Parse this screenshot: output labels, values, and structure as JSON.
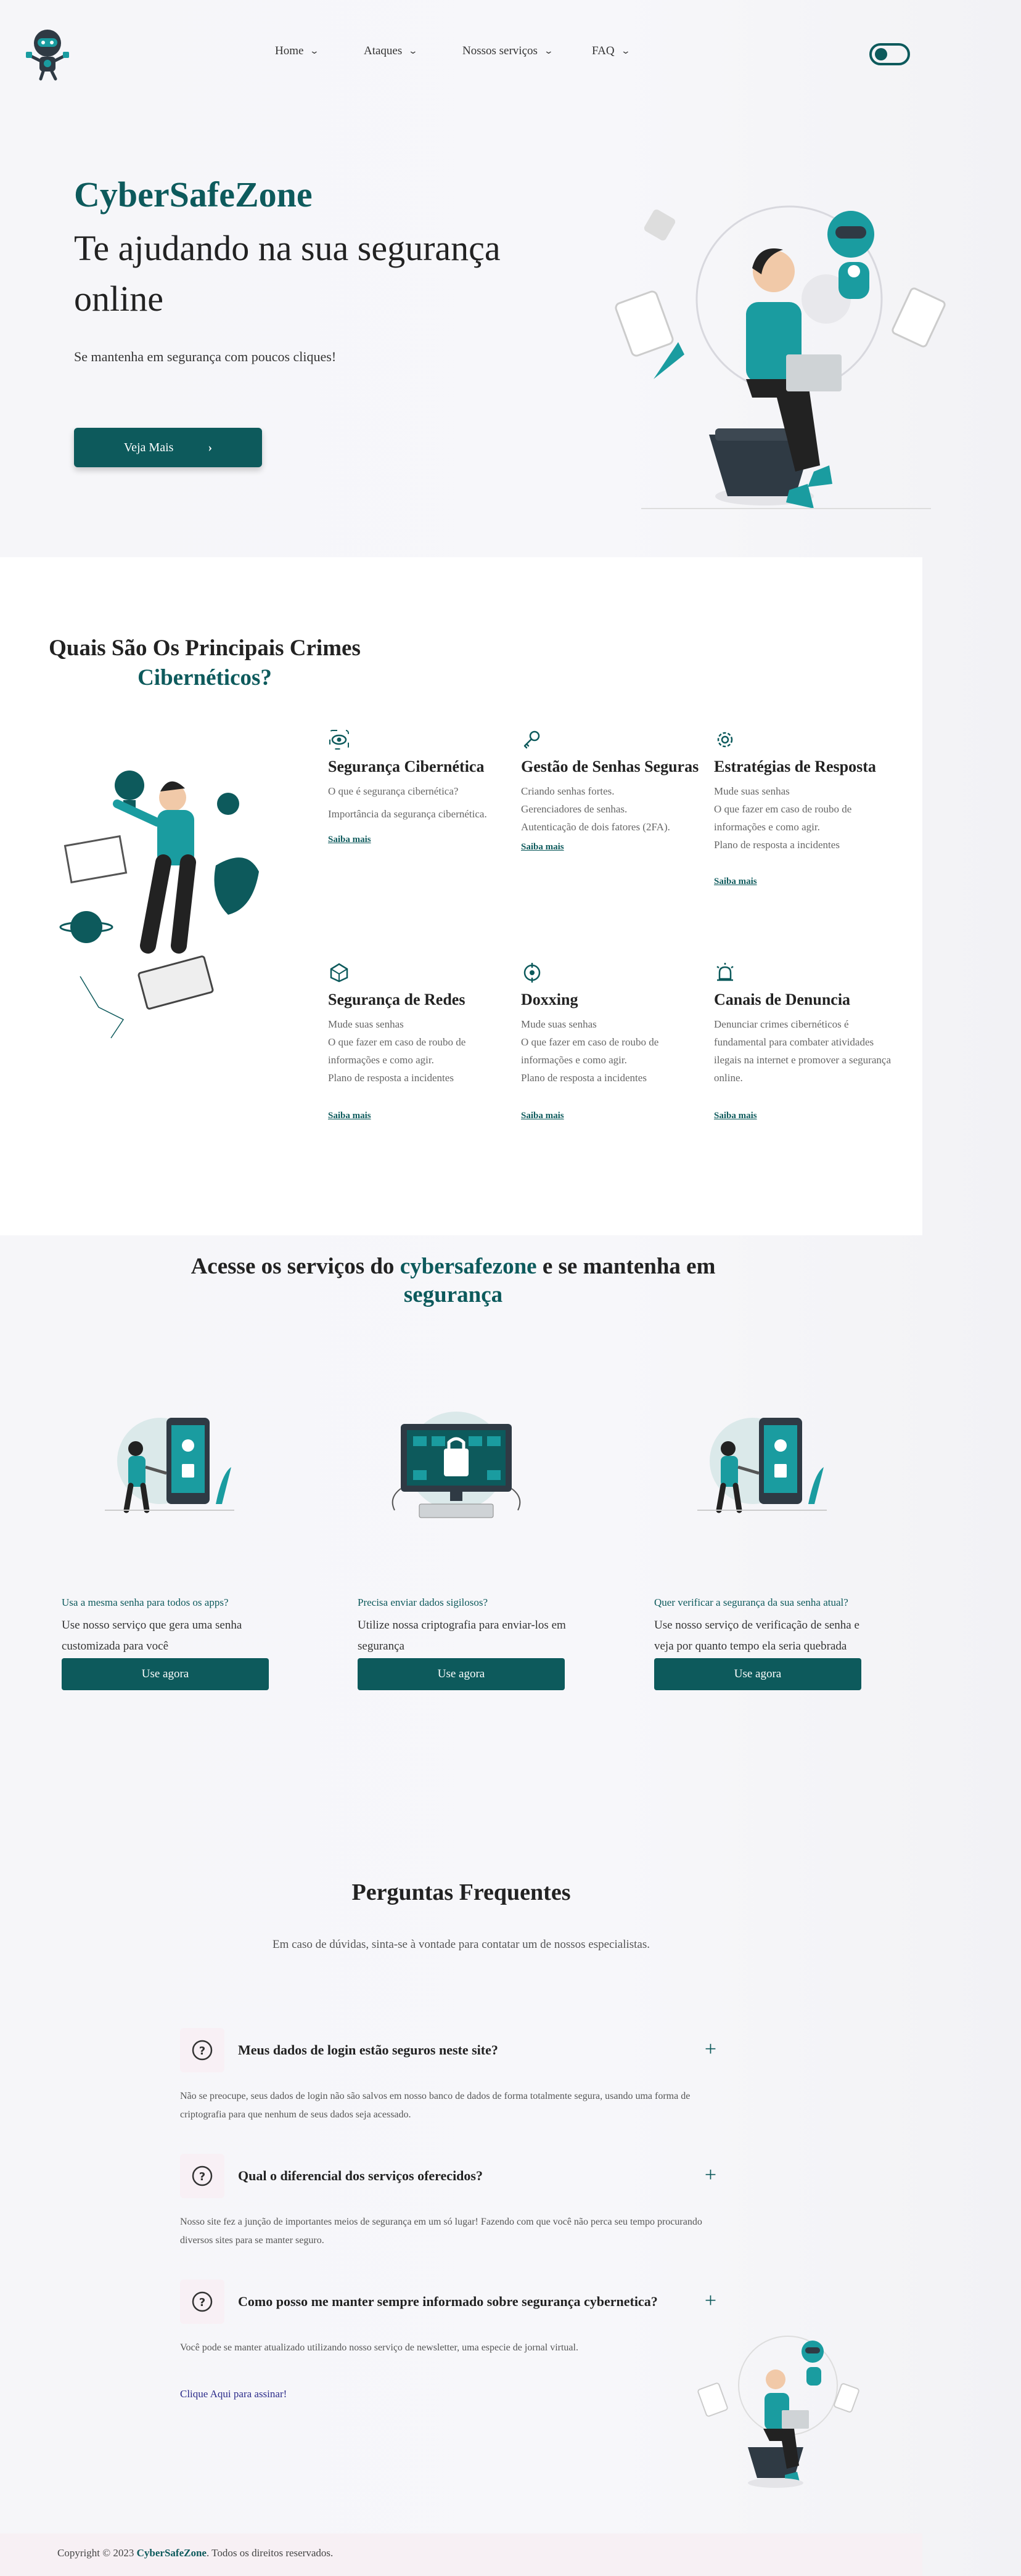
{
  "nav": {
    "items": [
      {
        "label": "Home"
      },
      {
        "label": "Ataques"
      },
      {
        "label": "Nossos serviços"
      },
      {
        "label": "FAQ"
      }
    ]
  },
  "hero": {
    "brand": "CyberSafeZone",
    "title": "Te ajudando na sua segurança online",
    "subtitle": "Se mantenha em segurança com poucos cliques!",
    "button_label": "Veja Mais"
  },
  "crimes": {
    "title_line1": "Quais São Os Principais Crimes",
    "title_line2": "Cibernéticos?",
    "cards": [
      {
        "icon": "eye-icon",
        "title": "Segurança Cibernética",
        "lines": [
          "O que é segurança cibernética?",
          "Importância da segurança cibernética."
        ],
        "link": "Saiba mais"
      },
      {
        "icon": "key-icon",
        "title": "Gestão de Senhas Seguras",
        "lines": [
          "Criando senhas fortes.",
          "Gerenciadores de senhas.",
          "Autenticação de dois fatores (2FA)."
        ],
        "link": "Saiba mais"
      },
      {
        "icon": "gear-icon",
        "title": "Estratégias de Resposta",
        "lines": [
          "Mude suas senhas",
          "O que fazer em caso de roubo de informações e como agir.",
          "Plano de resposta a incidentes"
        ],
        "link": "Saiba mais"
      },
      {
        "icon": "network-icon",
        "title": "Segurança de Redes",
        "lines": [
          "Mude suas senhas",
          "O que fazer em caso de roubo de informações e como agir.",
          "Plano de resposta a incidentes"
        ],
        "link": "Saiba mais"
      },
      {
        "icon": "target-icon",
        "title": "Doxxing",
        "lines": [
          "Mude suas senhas",
          "O que fazer em caso de roubo de informações e como agir.",
          "Plano de resposta a incidentes"
        ],
        "link": "Saiba mais"
      },
      {
        "icon": "alarm-icon",
        "title": "Canais de Denuncia",
        "lines": [
          "Denunciar crimes cibernéticos é fundamental para combater atividades ilegais na internet e promover a segurança online."
        ],
        "link": "Saiba mais"
      }
    ]
  },
  "services": {
    "title_pre": "Acesse os serviços do ",
    "title_brand": "cybersafezone",
    "title_mid": " e se mantenha em ",
    "title_end": "segurança",
    "items": [
      {
        "question": "Usa a mesma senha para todos os apps?",
        "desc": "Use nosso serviço que gera uma senha customizada para você",
        "button": "Use agora"
      },
      {
        "question": "Precisa enviar dados sigilosos?",
        "desc": "Utilize nossa criptografia para enviar-los em segurança",
        "button": "Use agora"
      },
      {
        "question": "Quer verificar a segurança da sua senha atual?",
        "desc": "Use nosso serviço de verificação de senha e veja por quanto tempo ela seria quebrada",
        "button": "Use agora"
      }
    ]
  },
  "faq": {
    "title": "Perguntas Frequentes",
    "subtitle": "Em caso de dúvidas, sinta-se à vontade para contatar um de nossos especialistas.",
    "items": [
      {
        "question": "Meus dados de login estão seguros neste site?",
        "answer": "Não se preocupe, seus dados de login não são salvos em nosso banco de dados de forma totalmente segura, usando uma forma de criptografia para que nenhum de seus dados seja acessado."
      },
      {
        "question": "Qual o diferencial dos serviços oferecidos?",
        "answer": "Nosso site fez a junção de importantes meios de segurança em um só lugar! Fazendo com que você não perca seu tempo procurando diversos sites para se manter seguro."
      },
      {
        "question": "Como posso me manter sempre informado sobre segurança cybernetica?",
        "answer": "Você pode se manter atualizado utilizando nosso serviço de newsletter, uma especie de jornal virtual."
      }
    ],
    "link": "Clique Aqui para assinar!"
  },
  "footer": {
    "pre": "Copyright © 2023 ",
    "brand": "CyberSafeZone",
    "post": ". Todos os direitos reservados."
  },
  "colors": {
    "accent": "#0d5a5c",
    "bright_teal": "#1a9ca0",
    "footer_bg": "#f7f0f4"
  }
}
